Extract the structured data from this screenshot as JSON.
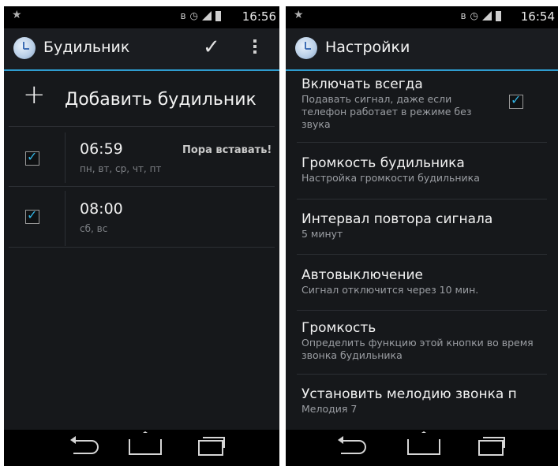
{
  "left": {
    "status": {
      "time": "16:56"
    },
    "action_bar": {
      "title": "Будильник"
    },
    "add_label": "Добавить будильник",
    "alarms": [
      {
        "time": "06:59",
        "days": "пн, вт, ср, чт, пт",
        "label": "Пора вставать!",
        "enabled": true
      },
      {
        "time": "08:00",
        "days": "сб, вс",
        "label": "",
        "enabled": true
      }
    ]
  },
  "right": {
    "status": {
      "time": "16:54"
    },
    "action_bar": {
      "title": "Настройки"
    },
    "prefs": [
      {
        "title": "Включать всегда",
        "summary": "Подавать сигнал, даже если телефон работает в режиме без звука",
        "checked": true
      },
      {
        "title": "Громкость будильника",
        "summary": "Настройка громкости будильника"
      },
      {
        "title": "Интервал повтора сигнала",
        "summary": "5 минут"
      },
      {
        "title": "Автовыключение",
        "summary": "Сигнал отключится через 10 мин."
      },
      {
        "title": "Громкость",
        "summary": "Определить функцию этой кнопки во время звонка будильника"
      },
      {
        "title": "Установить мелодию звонка п",
        "summary": "Мелодия 7"
      }
    ]
  },
  "icons": {
    "star": "star-icon",
    "bluetooth": "bluetooth-icon",
    "alarm": "alarm-icon",
    "signal": "signal-icon",
    "battery": "battery-icon",
    "check": "check-icon",
    "overflow": "overflow-menu-icon",
    "plus": "plus-icon",
    "back": "back-icon",
    "home": "home-icon",
    "recent": "recent-apps-icon"
  },
  "colors": {
    "accent": "#33b5e5",
    "divider": "#2f9dd0",
    "background": "#16181b"
  }
}
